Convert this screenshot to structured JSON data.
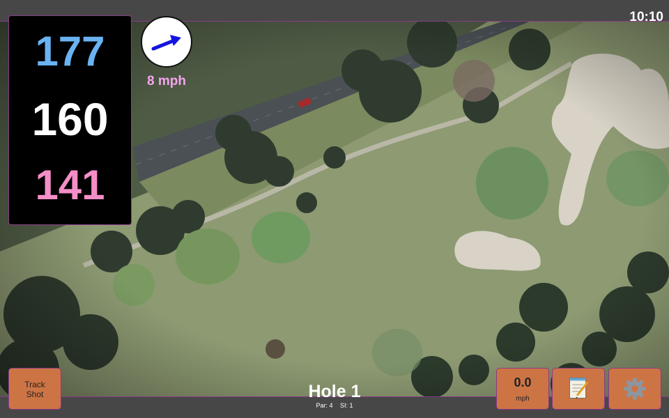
{
  "status_bar": {
    "time": "10:10"
  },
  "distances": {
    "back": "177",
    "middle": "160",
    "front": "141"
  },
  "wind": {
    "speed_label": "8 mph",
    "icon": "wind-arrow-icon"
  },
  "hole": {
    "title": "Hole 1",
    "par_label": "Par: 4",
    "si_label": "SI: 1"
  },
  "buttons": {
    "track_shot_line1": "Track",
    "track_shot_line2": "Shot",
    "speed_value": "0.0",
    "speed_unit": "mph",
    "notes_icon": "notepad-icon",
    "settings_icon": "gear-icon"
  },
  "colors": {
    "back_distance": "#6ab2f2",
    "middle_distance": "#ffffff",
    "front_distance": "#f48ec7",
    "wind_text": "#f6a3f0",
    "button_bg": "#cd7444",
    "accent_border": "#8a3a8a"
  }
}
